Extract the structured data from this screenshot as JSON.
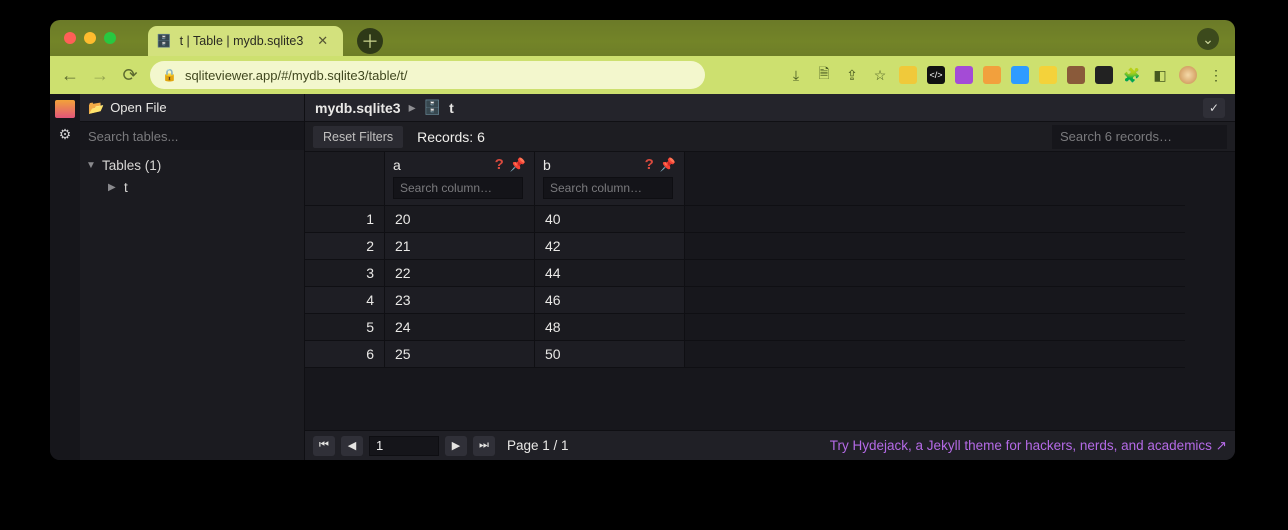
{
  "browser": {
    "tab_title": "t | Table | mydb.sqlite3",
    "url": "sqliteviewer.app/#/mydb.sqlite3/table/t/"
  },
  "sidebar": {
    "open_file_label": "Open File",
    "search_placeholder": "Search tables...",
    "tables_header": "Tables (1)",
    "tables": [
      "t"
    ]
  },
  "breadcrumb": {
    "db": "mydb.sqlite3",
    "table": "t"
  },
  "toolbar": {
    "reset_label": "Reset Filters",
    "records_label": "Records: 6",
    "search_placeholder": "Search 6 records…"
  },
  "columns": [
    {
      "name": "a",
      "filter_placeholder": "Search column…"
    },
    {
      "name": "b",
      "filter_placeholder": "Search column…"
    }
  ],
  "rows": [
    {
      "n": 1,
      "a": "20",
      "b": "40"
    },
    {
      "n": 2,
      "a": "21",
      "b": "42"
    },
    {
      "n": 3,
      "a": "22",
      "b": "44"
    },
    {
      "n": 4,
      "a": "23",
      "b": "46"
    },
    {
      "n": 5,
      "a": "24",
      "b": "48"
    },
    {
      "n": 6,
      "a": "25",
      "b": "50"
    }
  ],
  "footer": {
    "page_input": "1",
    "page_label": "Page 1 / 1",
    "promo": "Try Hydejack, a Jekyll theme for hackers, nerds, and academics ↗"
  }
}
